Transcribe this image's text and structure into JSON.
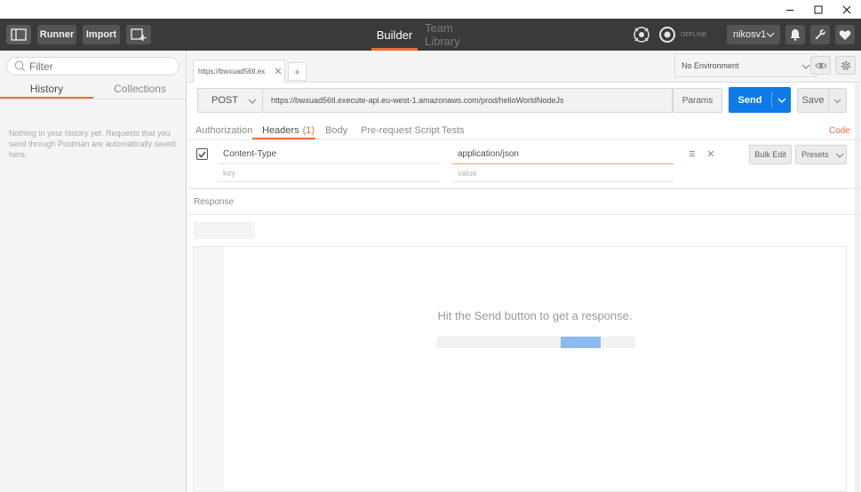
{
  "toolbar": {
    "runner_label": "Runner",
    "import_label": "Import",
    "tab_builder": "Builder",
    "tab_team_library": "Team Library",
    "offline_label": "OFFLINE",
    "user_label": "nikosv1"
  },
  "sidebar": {
    "filter_placeholder": "Filter",
    "tab_history": "History",
    "tab_collections": "Collections",
    "empty_message": "Nothing in your history yet. Requests that you send through Postman are automatically saved here."
  },
  "request_tabs": {
    "active_tab_label": "https://bwxuad56tl.ex",
    "add_tab": "+"
  },
  "environment": {
    "selected": "No Environment"
  },
  "request": {
    "method": "POST",
    "url": "https://bwxuad56tl.execute-api.eu-west-1.amazonaws.com/prod/helloWorldNodeJs",
    "params_label": "Params",
    "send_label": "Send",
    "save_label": "Save"
  },
  "subtabs": {
    "authorization": "Authorization",
    "headers": "Headers",
    "headers_count": "(1)",
    "body": "Body",
    "pre_request": "Pre-request Script",
    "tests": "Tests",
    "code": "Code"
  },
  "headers": {
    "rows": [
      {
        "key": "Content-Type",
        "value": "application/json"
      }
    ],
    "key_placeholder": "key",
    "value_placeholder": "value",
    "bulk_edit_label": "Bulk Edit",
    "presets_label": "Presets"
  },
  "response": {
    "title": "Response",
    "empty_message": "Hit the Send button to get a response."
  },
  "colors": {
    "accent_orange": "#f26b3a",
    "send_blue": "#0d7ae8",
    "toolbar_dark": "#3a3a3a"
  }
}
